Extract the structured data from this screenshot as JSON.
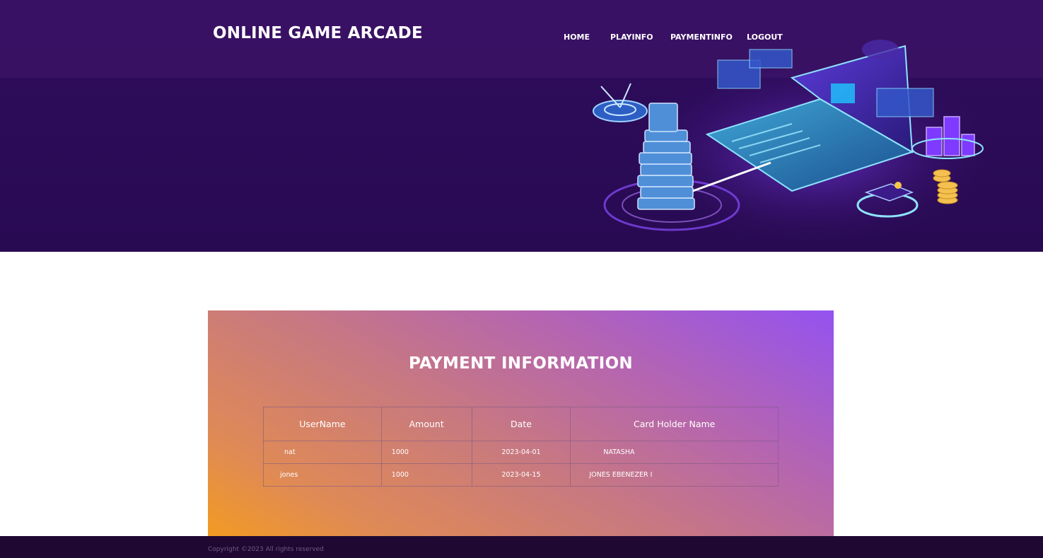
{
  "header": {
    "brand": "ONLINE GAME ARCADE",
    "nav": [
      {
        "label": "HOME"
      },
      {
        "label": "PLAYINFO"
      },
      {
        "label": "PAYMENTINFO"
      },
      {
        "label": "LOGOUT"
      }
    ]
  },
  "hero": {
    "illustration_icon": "tech-isometric-illustration"
  },
  "main": {
    "title": "PAYMENT INFORMATION",
    "table": {
      "columns": [
        "UserName",
        "Amount",
        "Date",
        "Card Holder Name"
      ],
      "rows": [
        [
          "nat",
          "1000",
          "2023-04-01",
          "NATASHA"
        ],
        [
          "jones",
          "1000",
          "2023-04-15",
          "JONES EBENEZER I"
        ]
      ]
    }
  },
  "footer": {
    "copyright": "Copyright ©2023 All rights reserved"
  },
  "colors": {
    "hero_background": "#2b0b57",
    "panel_gradient_start": "#f39c1f",
    "panel_gradient_end": "#9452f0",
    "footer_background": "#1f0933"
  }
}
